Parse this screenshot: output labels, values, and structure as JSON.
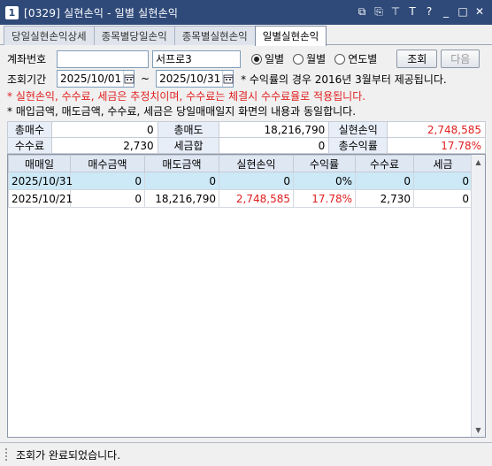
{
  "window": {
    "number": "1",
    "title": "[0329] 실현손익 - 일별 실현손익"
  },
  "title_icons": [
    "window-restore-icon",
    "copy-icon",
    "pin-icon",
    "text-size-icon",
    "help-icon",
    "minimize-icon",
    "maximize-icon",
    "close-icon"
  ],
  "title_icon_glyphs": {
    "restore": "⧉",
    "copy": "⎘",
    "pin": "⊤",
    "text": "T",
    "help": "?",
    "minimize": "_",
    "maximize": "□",
    "close": "✕"
  },
  "tabs": [
    {
      "label": "당일실현손익상세"
    },
    {
      "label": "종목별당일손익"
    },
    {
      "label": "종목별실현손익"
    },
    {
      "label": "일별실현손익",
      "active": true
    }
  ],
  "form": {
    "account_label": "계좌번호",
    "account_name": "서프로3",
    "period_label": "조회기간",
    "date_from": "2025/10/01",
    "date_to": "2025/10/31",
    "tilde": "~",
    "period_note": "* 수익률의 경우 2016년 3월부터 제공됩니다.",
    "radio_daily": "일별",
    "radio_monthly": "월별",
    "radio_yearly": "연도별",
    "search_button": "조회",
    "next_button": "다음",
    "note_red": "* 실현손익, 수수료, 세금은 추정치이며, 수수료는 체결시 수수료율로 적용됩니다.",
    "note_black": "* 매입금액, 매도금액, 수수료, 세금은 당일매매일지 화면의 내용과 동일합니다."
  },
  "summary": {
    "row1": {
      "h1": "총매수",
      "v1": "0",
      "h2": "총매도",
      "v2": "18,216,790",
      "h3": "실현손익",
      "v3": "2,748,585"
    },
    "row2": {
      "h1": "수수료",
      "v1": "2,730",
      "h2": "세금합",
      "v2": "0",
      "h3": "총수익률",
      "v3": "17.78%"
    }
  },
  "grid": {
    "headers": [
      "매매일",
      "매수금액",
      "매도금액",
      "실현손익",
      "수익률",
      "수수료",
      "세금"
    ],
    "rows": [
      [
        "2025/10/31",
        "0",
        "0",
        "0",
        "0%",
        "0",
        "0"
      ],
      [
        "2025/10/21",
        "0",
        "18,216,790",
        "2,748,585",
        "17.78%",
        "2,730",
        "0"
      ]
    ]
  },
  "status": {
    "text": "조회가 완료되었습니다."
  },
  "colors": {
    "titlebar": "#2f4a79",
    "red": "#e02020",
    "selected_row": "#cde8f6",
    "header_bg": "#dfe7f3"
  }
}
